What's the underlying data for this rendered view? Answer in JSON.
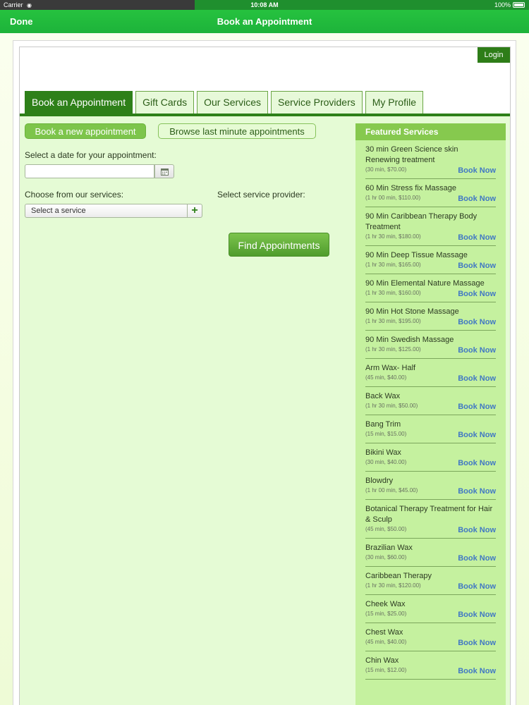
{
  "status_bar": {
    "carrier": "Carrier",
    "time": "10:08 AM",
    "battery": "100%"
  },
  "nav": {
    "done_label": "Done",
    "title": "Book an Appointment"
  },
  "login_label": "Login",
  "tabs": [
    {
      "label": "Book an Appointment"
    },
    {
      "label": "Gift Cards"
    },
    {
      "label": "Our Services"
    },
    {
      "label": "Service Providers"
    },
    {
      "label": "My Profile"
    }
  ],
  "actions": {
    "new_label": "Book a new appointment",
    "browse_label": "Browse last minute appointments"
  },
  "form": {
    "date_label": "Select a date for your appointment:",
    "date_value": "",
    "service_label": "Choose from our services:",
    "service_select": "Select a service",
    "provider_label": "Select service provider:",
    "find_label": "Find Appointments"
  },
  "featured": {
    "title": "Featured Services",
    "book_label": "Book Now",
    "items": [
      {
        "name": "30 min Green Science skin Renewing treatment",
        "meta": "(30 min, $70.00)"
      },
      {
        "name": "60 Min Stress fix Massage",
        "meta": "(1 hr 00 min, $110.00)"
      },
      {
        "name": "90 Min Caribbean Therapy Body Treatment",
        "meta": "(1 hr 30 min, $180.00)"
      },
      {
        "name": "90 Min Deep Tissue Massage",
        "meta": "(1 hr 30 min, $165.00)"
      },
      {
        "name": "90 Min Elemental Nature Massage",
        "meta": "(1 hr 30 min, $160.00)"
      },
      {
        "name": "90 Min Hot Stone Massage",
        "meta": "(1 hr 30 min, $195.00)"
      },
      {
        "name": "90 Min Swedish Massage",
        "meta": "(1 hr 30 min, $125.00)"
      },
      {
        "name": "Arm Wax- Half",
        "meta": "(45 min, $40.00)"
      },
      {
        "name": "Back Wax",
        "meta": "(1 hr 30 min, $50.00)"
      },
      {
        "name": "Bang Trim",
        "meta": "(15 min, $15.00)"
      },
      {
        "name": "Bikini Wax",
        "meta": "(30 min, $40.00)"
      },
      {
        "name": "Blowdry",
        "meta": "(1 hr 00 min, $45.00)"
      },
      {
        "name": "Botanical Therapy Treatment for Hair & Sculp",
        "meta": "(45 min, $50.00)"
      },
      {
        "name": "Brazilian Wax",
        "meta": "(30 min, $60.00)"
      },
      {
        "name": "Caribbean Therapy",
        "meta": "(1 hr 30 min, $120.00)"
      },
      {
        "name": "Cheek Wax",
        "meta": "(15 min, $25.00)"
      },
      {
        "name": "Chest Wax",
        "meta": "(45 min, $40.00)"
      },
      {
        "name": "Chin Wax",
        "meta": "(15 min, $12.00)"
      }
    ]
  }
}
